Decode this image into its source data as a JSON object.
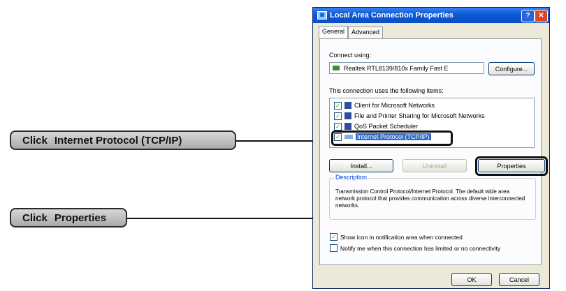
{
  "callouts": {
    "tcp": {
      "verb": "Click",
      "target": "Internet Protocol (TCP/IP)"
    },
    "properties": {
      "verb": "Click",
      "target": "Properties"
    }
  },
  "dialog": {
    "title": "Local Area Connection Properties",
    "help_label": "?",
    "close_label": "✕",
    "tabs": [
      "General",
      "Advanced"
    ],
    "connect_using_label": "Connect using:",
    "adapter_name": "Realtek RTL8139/810x Family Fast E",
    "configure_label": "Configure...",
    "items_label": "This connection uses the following items:",
    "items": [
      {
        "label": "Client for Microsoft Networks",
        "checked": true,
        "icon": "network-client-icon"
      },
      {
        "label": "File and Printer Sharing for Microsoft Networks",
        "checked": true,
        "icon": "printer-sharing-icon"
      },
      {
        "label": "QoS Packet Scheduler",
        "checked": true,
        "icon": "scheduler-icon"
      },
      {
        "label": "Internet Protocol (TCP/IP)",
        "checked": true,
        "selected": true,
        "icon": "protocol-icon"
      }
    ],
    "install_label": "Install...",
    "uninstall_label": "Uninstall",
    "properties_label": "Properties",
    "description_legend": "Description",
    "description_text": "Transmission Control Protocol/Internet Protocol. The default wide area network protocol that provides communication across diverse interconnected networks.",
    "show_icon_label": "Show icon in notification area when connected",
    "notify_label": "Notify me when this connection has limited or no connectivity",
    "ok_label": "OK",
    "cancel_label": "Cancel"
  }
}
